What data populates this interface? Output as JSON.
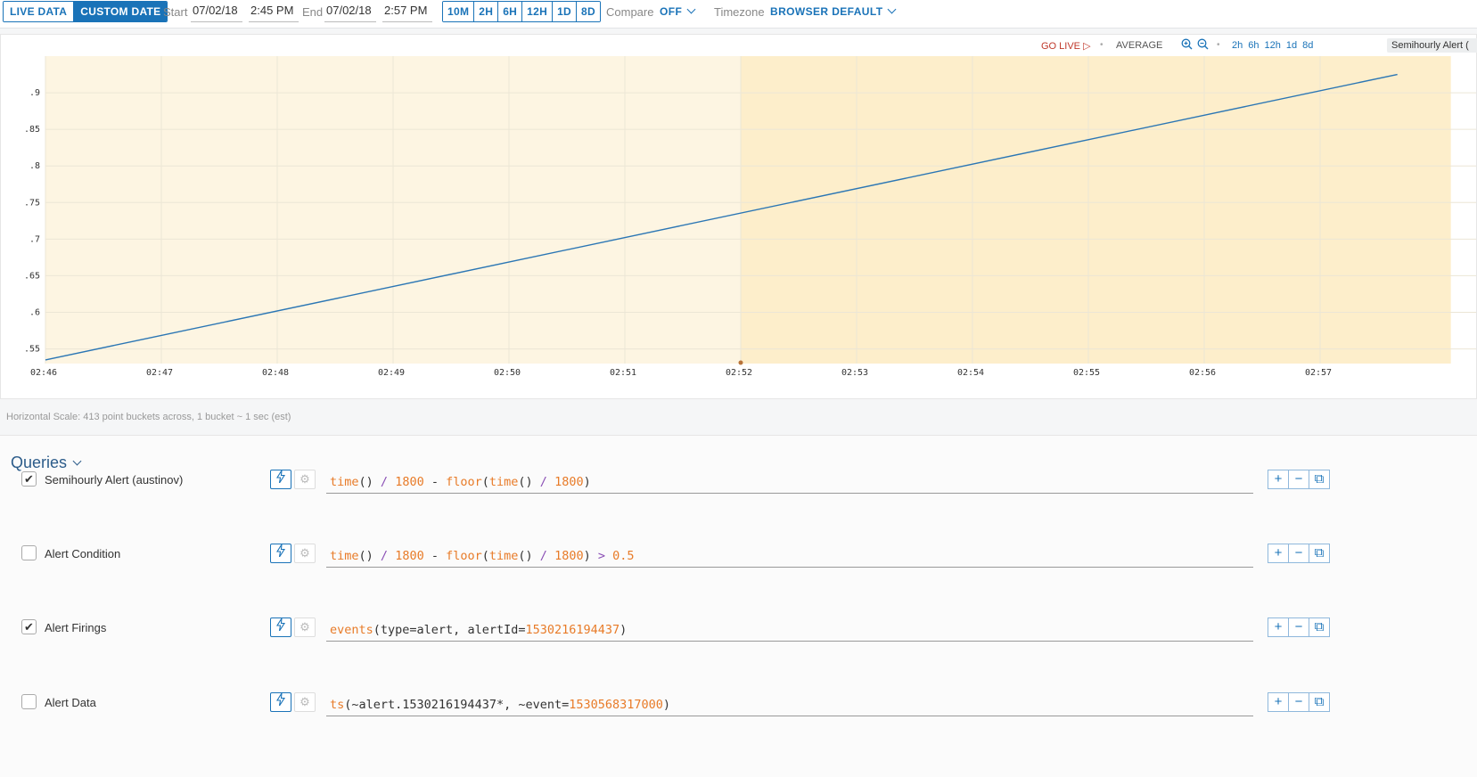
{
  "topbar": {
    "live_data": "LIVE DATA",
    "custom_date": "CUSTOM DATE",
    "start_label": "Start",
    "start_date": "07/02/18",
    "start_time": "2:45 PM",
    "end_label": "End",
    "end_date": "07/02/18",
    "end_time": "2:57 PM",
    "ranges": [
      "10M",
      "2H",
      "6H",
      "12H",
      "1D",
      "8D"
    ],
    "compare_label": "Compare",
    "compare_value": "OFF",
    "timezone_label": "Timezone",
    "timezone_value": "BROWSER DEFAULT"
  },
  "chart_toolbar": {
    "go_live": "GO LIVE",
    "average": "AVERAGE",
    "spans": [
      "2h",
      "6h",
      "12h",
      "1d",
      "8d"
    ],
    "series_tag": "Semihourly Alert ("
  },
  "chart_data": {
    "type": "line",
    "x_ticks": [
      "02:46",
      "02:47",
      "02:48",
      "02:49",
      "02:50",
      "02:51",
      "02:52",
      "02:53",
      "02:54",
      "02:55",
      "02:56",
      "02:57"
    ],
    "y_ticks": [
      ".55",
      ".6",
      ".65",
      ".7",
      ".75",
      ".8",
      ".85",
      ".9"
    ],
    "ylim": [
      0.53,
      0.95
    ],
    "series": [
      {
        "x": [
          "02:46",
          "02:57:40"
        ],
        "values": [
          0.535,
          0.925
        ],
        "color": "#2b76b4"
      }
    ],
    "shaded_regions": [
      {
        "from": "02:46",
        "to": "02:52",
        "color": "#fdf5e2"
      },
      {
        "from": "02:52",
        "to": "02:57:40",
        "color": "#fdeecb"
      }
    ],
    "event_marker": "02:52",
    "grid": true
  },
  "horizontal_scale": "Horizontal Scale: 413 point buckets across, 1 bucket ~ 1 sec (est)",
  "queries": {
    "title": "Queries",
    "rows": [
      {
        "name": "Semihourly Alert (austinov)",
        "checked": true,
        "tokens": [
          [
            "fn",
            "time"
          ],
          [
            "p",
            "() "
          ],
          [
            "op",
            "/"
          ],
          [
            "p",
            " "
          ],
          [
            "num",
            "1800"
          ],
          [
            "p",
            " - "
          ],
          [
            "fn",
            "floor"
          ],
          [
            "p",
            "("
          ],
          [
            "fn",
            "time"
          ],
          [
            "p",
            "() "
          ],
          [
            "op",
            "/"
          ],
          [
            "p",
            " "
          ],
          [
            "num",
            "1800"
          ],
          [
            "p",
            ")"
          ]
        ]
      },
      {
        "name": "Alert Condition",
        "checked": false,
        "tokens": [
          [
            "fn",
            "time"
          ],
          [
            "p",
            "() "
          ],
          [
            "op",
            "/"
          ],
          [
            "p",
            " "
          ],
          [
            "num",
            "1800"
          ],
          [
            "p",
            " - "
          ],
          [
            "fn",
            "floor"
          ],
          [
            "p",
            "("
          ],
          [
            "fn",
            "time"
          ],
          [
            "p",
            "() "
          ],
          [
            "op",
            "/"
          ],
          [
            "p",
            " "
          ],
          [
            "num",
            "1800"
          ],
          [
            "p",
            ") "
          ],
          [
            "op",
            ">"
          ],
          [
            "p",
            " "
          ],
          [
            "num",
            "0.5"
          ]
        ]
      },
      {
        "name": "Alert Firings",
        "checked": true,
        "tokens": [
          [
            "fn",
            "events"
          ],
          [
            "p",
            "(type=alert, alertId="
          ],
          [
            "num",
            "1530216194437"
          ],
          [
            "p",
            ")"
          ]
        ]
      },
      {
        "name": "Alert Data",
        "checked": false,
        "tokens": [
          [
            "fn",
            "ts"
          ],
          [
            "p",
            "(~alert.1530216194437*, ~event="
          ],
          [
            "num",
            "1530568317000"
          ],
          [
            "p",
            ")"
          ]
        ]
      }
    ]
  }
}
